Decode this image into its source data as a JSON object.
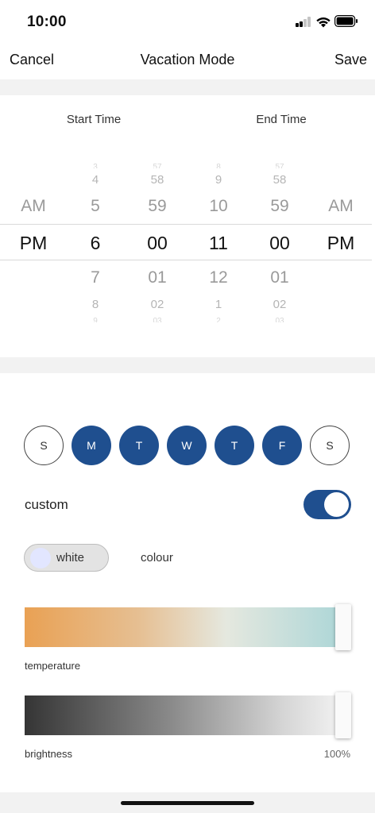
{
  "status_bar": {
    "time": "10:00"
  },
  "nav": {
    "cancel": "Cancel",
    "title": "Vacation Mode",
    "save": "Save"
  },
  "picker": {
    "start_heading": "Start Time",
    "end_heading": "End Time",
    "columns": [
      {
        "name": "start-ampm",
        "values": [
          "",
          "",
          "AM",
          "PM",
          "",
          "",
          ""
        ]
      },
      {
        "name": "start-hour",
        "values": [
          "3",
          "4",
          "5",
          "6",
          "7",
          "8",
          "9"
        ]
      },
      {
        "name": "start-minute",
        "values": [
          "57",
          "58",
          "59",
          "00",
          "01",
          "02",
          "03"
        ]
      },
      {
        "name": "end-hour",
        "values": [
          "8",
          "9",
          "10",
          "11",
          "12",
          "1",
          "2"
        ]
      },
      {
        "name": "end-minute",
        "values": [
          "57",
          "58",
          "59",
          "00",
          "01",
          "02",
          "03"
        ]
      },
      {
        "name": "end-ampm",
        "values": [
          "",
          "",
          "AM",
          "PM",
          "",
          "",
          ""
        ]
      }
    ]
  },
  "days": [
    {
      "label": "S",
      "selected": false
    },
    {
      "label": "M",
      "selected": true
    },
    {
      "label": "T",
      "selected": true
    },
    {
      "label": "W",
      "selected": true
    },
    {
      "label": "T",
      "selected": true
    },
    {
      "label": "F",
      "selected": true
    },
    {
      "label": "S",
      "selected": false
    }
  ],
  "custom": {
    "label": "custom",
    "enabled": true
  },
  "mode": {
    "white_label": "white",
    "colour_label": "colour",
    "selected": "white"
  },
  "temperature": {
    "label": "temperature",
    "value_fraction": 1.0
  },
  "brightness": {
    "label": "brightness",
    "value": "100%",
    "value_fraction": 1.0
  },
  "colors": {
    "accent": "#1f4f8f",
    "background_strip": "#f2f2f2"
  }
}
